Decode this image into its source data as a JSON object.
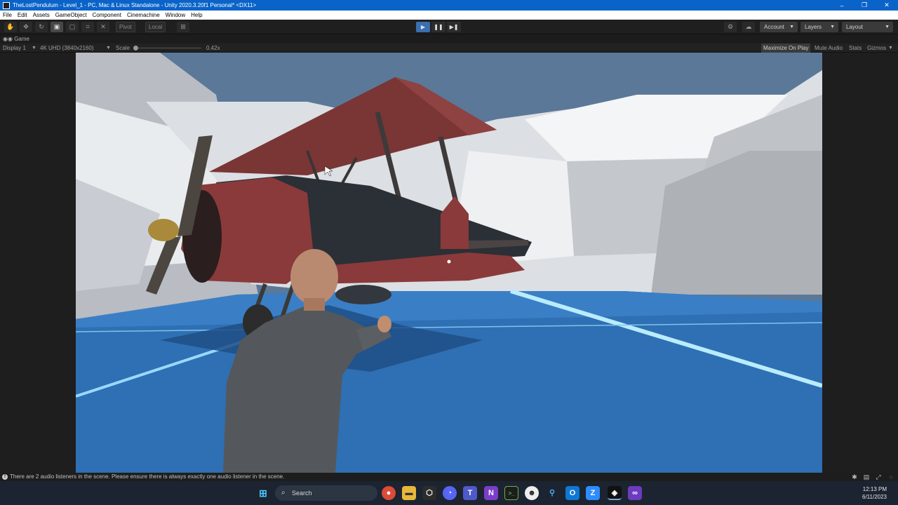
{
  "window": {
    "title": "TheLostPendulum - Level_1 - PC, Mac & Linux Standalone - Unity 2020.3.20f1 Personal* <DX11>",
    "controls": [
      "–",
      "❐",
      "✕"
    ]
  },
  "menu": {
    "items": [
      "File",
      "Edit",
      "Assets",
      "GameObject",
      "Component",
      "Cinemachine",
      "Window",
      "Help"
    ]
  },
  "toolbar": {
    "pivot_label": "Pivot",
    "local_label": "Local",
    "account_label": "Account",
    "layers_label": "Layers",
    "layout_label": "Layout",
    "play_state": "playing"
  },
  "game_tab": {
    "label": "Game"
  },
  "game_bar": {
    "display": "Display 1",
    "resolution": "4K UHD (3840x2160)",
    "scale_label": "Scale",
    "scale_value": "0.42x",
    "maximize_on_play": "Maximize On Play",
    "mute_audio": "Mute Audio",
    "stats": "Stats",
    "gizmos": "Gizmos"
  },
  "status": {
    "message": "There are 2 audio listeners in the scene. Please ensure there is always exactly one audio listener in the scene."
  },
  "taskbar": {
    "search_label": "Search",
    "time": "12:13 PM",
    "date": "6/11/2023",
    "icons": [
      "windows-start-icon",
      "chrome-icon",
      "file-explorer-icon",
      "unity-hub-icon",
      "discord-icon",
      "teams-icon",
      "visual-studio-purple-icon",
      "terminal-icon",
      "gamepad-icon",
      "maps-icon",
      "outlook-icon",
      "z-app-icon",
      "unity-icon",
      "visual-studio-icon"
    ]
  },
  "colors": {
    "title_bar": "#0a63c9",
    "play_active": "#3a6fb0",
    "ground": "#2f6fb3",
    "ground_lines": "#9ad8ff",
    "plane_body": "#8a3a3a"
  }
}
